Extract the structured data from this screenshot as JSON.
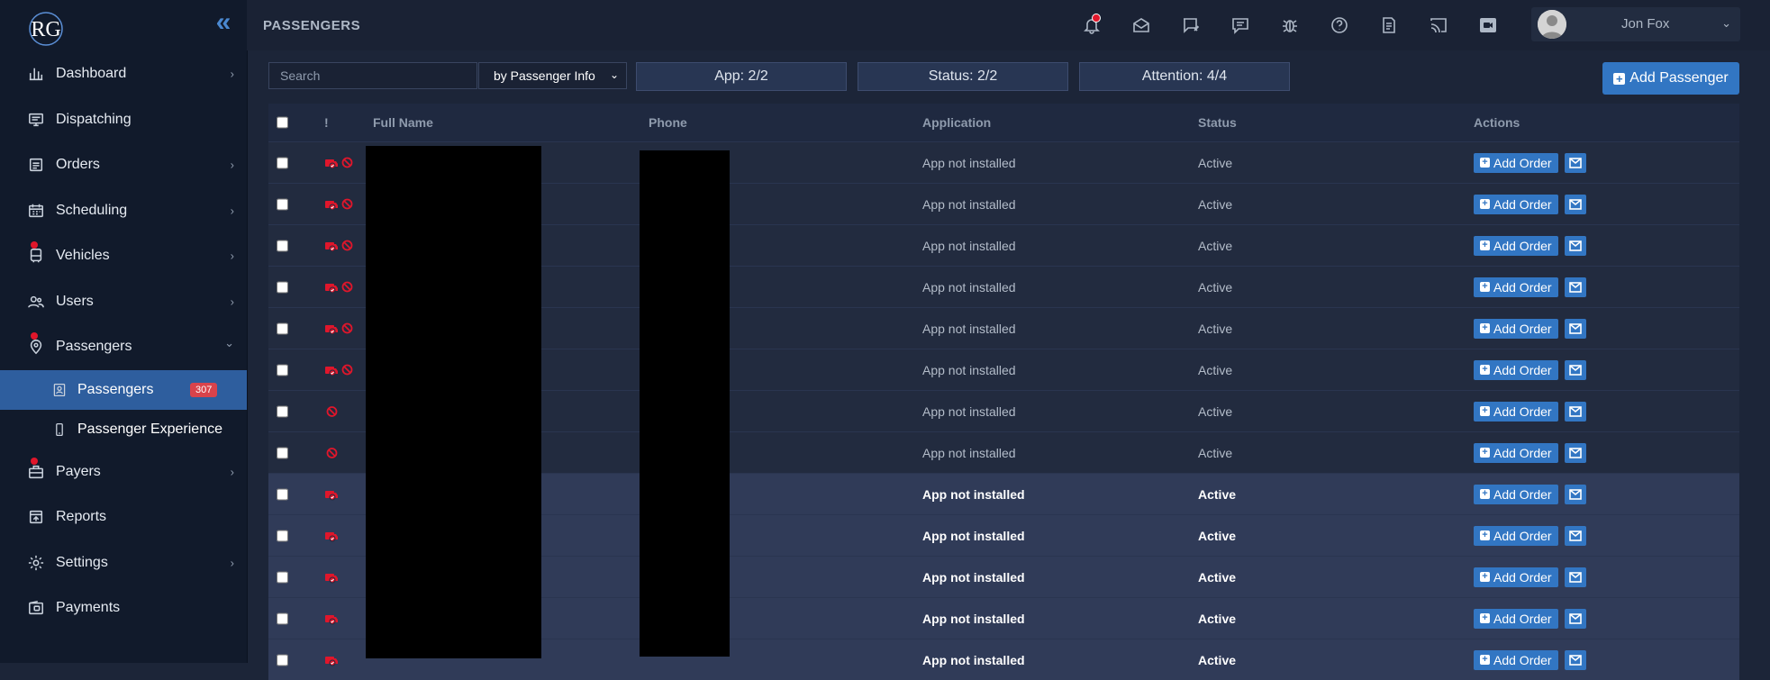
{
  "sidebar": {
    "collapse_glyph": "«",
    "items": [
      {
        "label": "Dashboard",
        "icon": "chart-bar-icon",
        "chevron": true,
        "dot": false
      },
      {
        "label": "Dispatching",
        "icon": "monitor-icon",
        "chevron": false,
        "dot": false
      },
      {
        "label": "Orders",
        "icon": "clipboard-icon",
        "chevron": true,
        "dot": false
      },
      {
        "label": "Scheduling",
        "icon": "calendar-icon",
        "chevron": true,
        "dot": false
      },
      {
        "label": "Vehicles",
        "icon": "bus-icon",
        "chevron": true,
        "dot": true
      },
      {
        "label": "Users",
        "icon": "users-icon",
        "chevron": true,
        "dot": false
      },
      {
        "label": "Passengers",
        "icon": "location-icon",
        "chevron": true,
        "dot": true,
        "expanded": true
      }
    ],
    "sub_items": [
      {
        "label": "Passengers",
        "badge": "307",
        "active": true,
        "icon": "id-card-icon"
      },
      {
        "label": "Passenger Experience",
        "active": false,
        "icon": "phone-icon"
      }
    ],
    "items_after": [
      {
        "label": "Payers",
        "icon": "briefcase-icon",
        "chevron": true,
        "dot": true
      },
      {
        "label": "Reports",
        "icon": "report-icon",
        "chevron": false,
        "dot": false
      },
      {
        "label": "Settings",
        "icon": "gear-icon",
        "chevron": true,
        "dot": false
      },
      {
        "label": "Payments",
        "icon": "wallet-icon",
        "chevron": false,
        "dot": false
      }
    ]
  },
  "header": {
    "title": "PASSENGERS",
    "icons": [
      "bell-icon",
      "envelope-open-icon",
      "message-edit-icon",
      "chat-icon",
      "bug-icon",
      "help-icon",
      "document-icon",
      "cast-icon",
      "video-icon"
    ],
    "user_name": "Jon Fox"
  },
  "filters": {
    "search_placeholder": "Search",
    "search_by": "by Passenger Info",
    "app": "App: 2/2",
    "status": "Status: 2/2",
    "attention": "Attention: 4/4"
  },
  "add_passenger_label": "Add Passenger",
  "table": {
    "columns": {
      "attention": "!",
      "full_name": "Full Name",
      "phone": "Phone",
      "application": "Application",
      "status": "Status",
      "actions": "Actions"
    },
    "add_order_label": "Add Order",
    "rows": [
      {
        "flags": [
          "vehicle",
          "blocked"
        ],
        "application": "App not installed",
        "status": "Active",
        "style": "a"
      },
      {
        "flags": [
          "vehicle",
          "blocked"
        ],
        "application": "App not installed",
        "status": "Active",
        "style": "a"
      },
      {
        "flags": [
          "vehicle",
          "blocked"
        ],
        "application": "App not installed",
        "status": "Active",
        "style": "a"
      },
      {
        "flags": [
          "vehicle",
          "blocked"
        ],
        "application": "App not installed",
        "status": "Active",
        "style": "a"
      },
      {
        "flags": [
          "vehicle",
          "blocked"
        ],
        "application": "App not installed",
        "status": "Active",
        "style": "a"
      },
      {
        "flags": [
          "vehicle",
          "blocked"
        ],
        "application": "App not installed",
        "status": "Active",
        "style": "a"
      },
      {
        "flags": [
          "blocked"
        ],
        "application": "App not installed",
        "status": "Active",
        "style": "a"
      },
      {
        "flags": [
          "blocked"
        ],
        "application": "App not installed",
        "status": "Active",
        "style": "a"
      },
      {
        "flags": [
          "vehicle"
        ],
        "application": "App not installed",
        "status": "Active",
        "style": "b"
      },
      {
        "flags": [
          "vehicle"
        ],
        "application": "App not installed",
        "status": "Active",
        "style": "b"
      },
      {
        "flags": [
          "vehicle"
        ],
        "application": "App not installed",
        "status": "Active",
        "style": "b"
      },
      {
        "flags": [
          "vehicle"
        ],
        "application": "App not installed",
        "status": "Active",
        "style": "b"
      },
      {
        "flags": [
          "vehicle"
        ],
        "application": "App not installed",
        "status": "Active",
        "style": "b"
      }
    ]
  },
  "colors": {
    "accent": "#3276c3",
    "alert": "#e0162b",
    "sidebar_active": "#2e5e9e",
    "badge": "#d9434b"
  }
}
